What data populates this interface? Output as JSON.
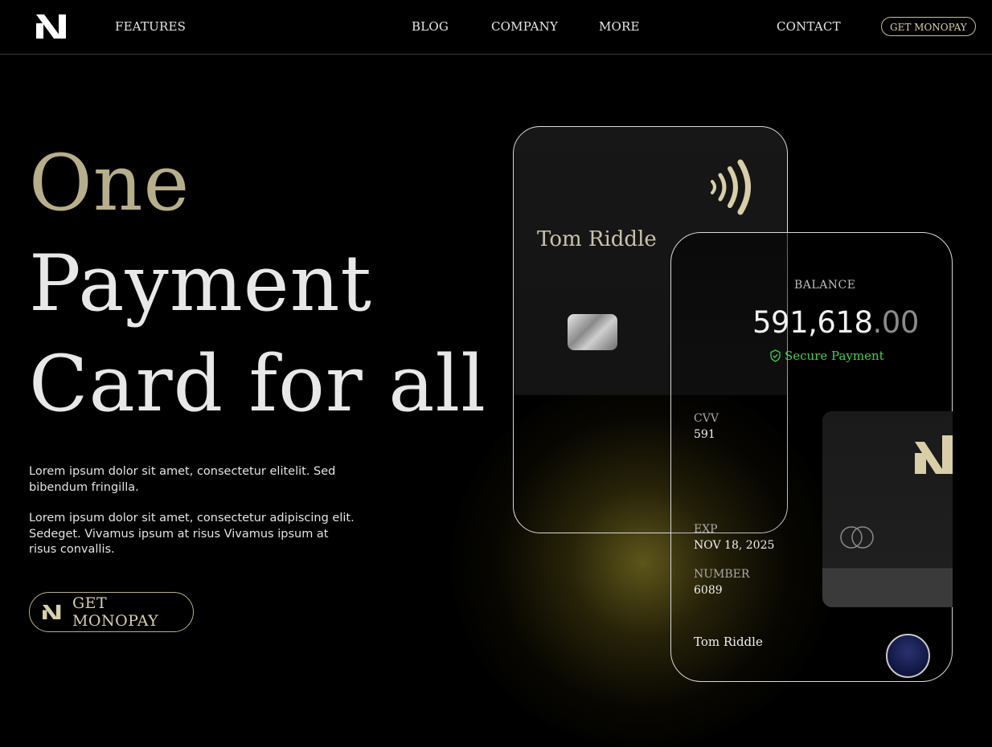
{
  "nav": {
    "logo_icon": "monopay-logo-icon",
    "links": [
      "FEATURES",
      "BLOG",
      "COMPANY",
      "MORE",
      "CONTACT"
    ],
    "cta_label": "GET MONOPAY"
  },
  "hero": {
    "line1": "One",
    "line2": "Payment",
    "line3": "Card for all",
    "paragraph1": "Lorem ipsum dolor sit amet, consectetur elitelit. Sed bibendum fringilla.",
    "paragraph2": "Lorem ipsum dolor sit amet, consectetur adipiscing elit. Sedeget. Vivamus ipsum at risus Vivamus ipsum at risus convallis.",
    "cta_label": "GET MONOPAY"
  },
  "card_front": {
    "holder": "Tom Riddle",
    "contactless_icon": "contactless-icon",
    "chip_icon": "chip-icon"
  },
  "card_back": {
    "balance_label": "BALANCE",
    "balance_whole": "591,618",
    "balance_decimal": ".00",
    "secure_label": "Secure Payment",
    "cvv_label": "CVV",
    "cvv_value": "591",
    "exp_label": "EXP",
    "exp_value": "NOV 18, 2025",
    "number_label": "NUMBER",
    "number_value": "6089",
    "holder": "Tom Riddle"
  },
  "colors": {
    "accent_gold": "#b7ae8a",
    "secure_green": "#3fd24a",
    "background": "#000000"
  }
}
